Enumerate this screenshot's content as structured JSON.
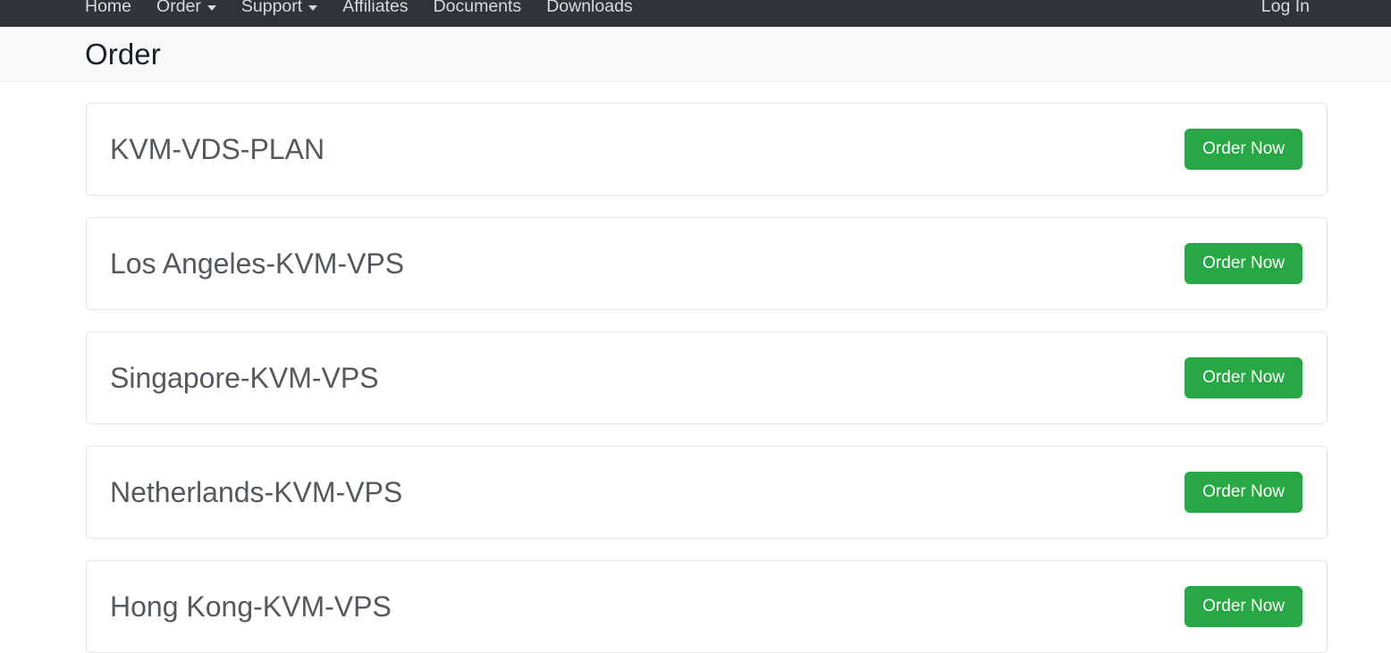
{
  "navbar": {
    "brand_bg": "#2f3438",
    "items": [
      {
        "label": "Home",
        "has_caret": false
      },
      {
        "label": "Order",
        "has_caret": true
      },
      {
        "label": "Support",
        "has_caret": true
      },
      {
        "label": "Affiliates",
        "has_caret": false
      },
      {
        "label": "Documents",
        "has_caret": false
      },
      {
        "label": "Downloads",
        "has_caret": false
      }
    ],
    "login_label": "Log In"
  },
  "header": {
    "title": "Order"
  },
  "accent_green": "#28a745",
  "cards": [
    {
      "title": "KVM-VDS-PLAN",
      "button_label": "Order Now"
    },
    {
      "title": "Los Angeles-KVM-VPS",
      "button_label": "Order Now"
    },
    {
      "title": "Singapore-KVM-VPS",
      "button_label": "Order Now"
    },
    {
      "title": "Netherlands-KVM-VPS",
      "button_label": "Order Now"
    },
    {
      "title": "Hong Kong-KVM-VPS",
      "button_label": "Order Now"
    }
  ]
}
